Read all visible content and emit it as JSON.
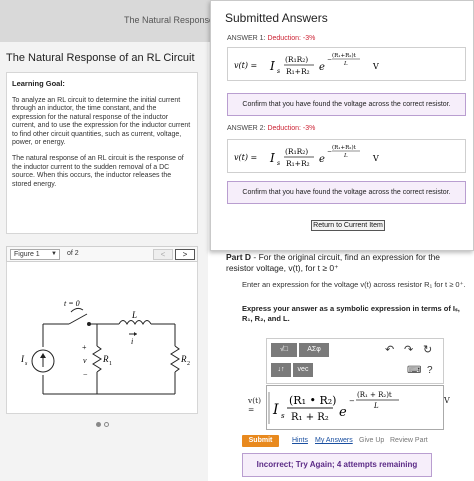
{
  "header": {
    "tab_title": "The Natural Response o"
  },
  "left": {
    "title": "The Natural Response of an RL Circuit",
    "goal_heading": "Learning Goal:",
    "goal_p1": "To analyze an RL circuit to determine the initial current through an inductor, the time constant, and the expression for the natural response of the inductor current, and to use the expression for the inductor current to find other circuit quantities, such as current, voltage, power, or energy.",
    "goal_p2": "The natural response of an RL circuit is the response of the inductor current to the sudden removal of a DC source. When this occurs, the inductor releases the stored energy.",
    "figure": {
      "select_value": "Figure 1",
      "of_text": "of 2",
      "prev": "<",
      "next": ">",
      "switch_label": "t = 0",
      "source_label": "I",
      "source_sub": "s",
      "r1_label": "R",
      "r1_sub": "1",
      "r2_label": "R",
      "r2_sub": "2",
      "l_label": "L",
      "i_label": "i",
      "v_label": "v",
      "plus": "+",
      "minus": "−"
    }
  },
  "popup": {
    "title": "Submitted Answers",
    "answer1": {
      "label": "ANSWER 1: ",
      "deduction": "Deduction: -3%"
    },
    "answer2": {
      "label": "ANSWER 2: ",
      "deduction": "Deduction: -3%"
    },
    "confirm_text": "Confirm that you have found the voltage across the correct resistor.",
    "return_label": "Return to Current Item",
    "unit": "V"
  },
  "math": {
    "vt": "v(t) =",
    "I": "I",
    "s": "s",
    "num": "(R₁R₂)",
    "den": "R₁+R₂",
    "e": "e",
    "exp_num": "(R₁+R₂)t",
    "exp_den": "L",
    "minus": "−"
  },
  "partd": {
    "label": "Part D",
    "question": " - For the original circuit, find an expression for the resistor voltage, v(t), for t ≥ 0⁺",
    "enter_text": "Enter an expression for the voltage v(t) across resistor R₁ for t ≥ 0⁺.",
    "express_text": "Express your answer as a symbolic expression in terms of Iₛ, R₁, R₂, and L."
  },
  "toolbar": {
    "templates": "√□",
    "greek": "AΣφ",
    "subscript": "↓↑",
    "vec": "vec",
    "undo": "↶",
    "redo": "↷",
    "reset": "↻",
    "keyboard": "⌨",
    "help": "?"
  },
  "answer_field": {
    "vt_label": "v(t)",
    "equals": "=",
    "I": "I",
    "s": "s",
    "num": "(R₁ • R₂)",
    "den": "R₁ + R₂",
    "e": "e",
    "exp_num": "(R₁ + R₂)t",
    "exp_den": "L",
    "minus": "−",
    "unit": "V"
  },
  "actions": {
    "submit": "Submit",
    "hints": "Hints",
    "my_answers": "My Answers",
    "give_up": "Give Up",
    "review_part": "Review Part"
  },
  "feedback": {
    "incorrect_text": "Incorrect; Try Again; 4 attempts remaining"
  },
  "colors": {
    "accent_orange": "#e8891e",
    "deduction_red": "#cc2233",
    "feedback_purple": "#5b2a86",
    "link_blue": "#1a4fa0"
  }
}
